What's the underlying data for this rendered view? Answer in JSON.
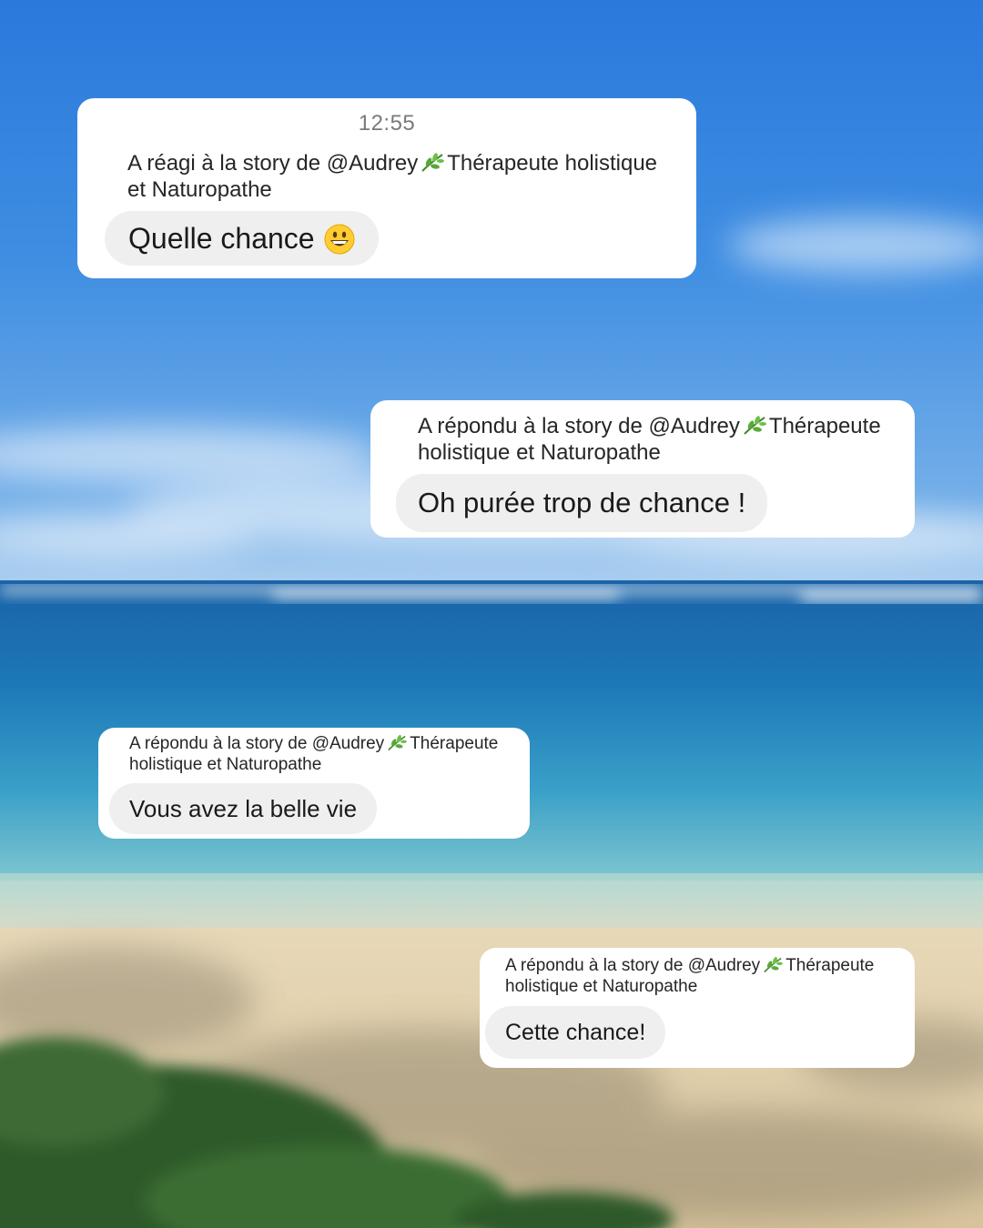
{
  "messages": [
    {
      "time": "12:55",
      "context_prefix": "A réagi à la story de @Audrey",
      "context_suffix": "Thérapeute holistique",
      "context_line2": "et Naturopathe",
      "text": "Quelle chance",
      "emoji": "grinning-face-icon"
    },
    {
      "context_prefix": "A répondu à la story de @Audrey",
      "context_suffix": "Thérapeute",
      "context_line2": "holistique et Naturopathe",
      "text": "Oh purée trop de chance !"
    },
    {
      "context_prefix": "A répondu à la story de @Audrey",
      "context_suffix": "Thérapeute",
      "context_line2": "holistique et Naturopathe",
      "text": "Vous avez la belle vie"
    },
    {
      "context_prefix": "A répondu à la story de @Audrey",
      "context_suffix": "Thérapeute",
      "context_line2": "holistique et Naturopathe",
      "text": "Cette chance!"
    }
  ],
  "icons": {
    "leaf": "herb-leaf-icon"
  },
  "colors": {
    "sky": "#2f7fdc",
    "sea": "#1f78b4",
    "sand": "#e3d2b0",
    "card": "#ffffff",
    "bubble": "#efefef"
  }
}
